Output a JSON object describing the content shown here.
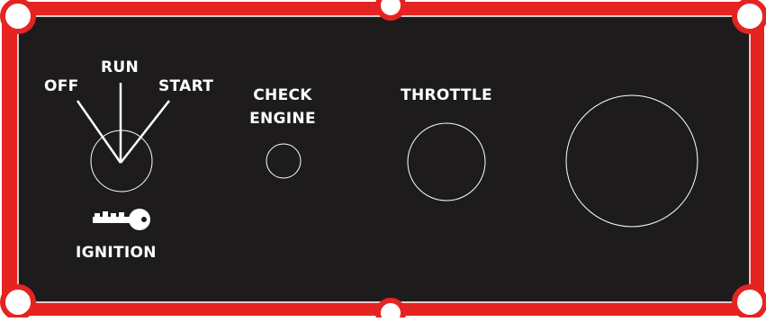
{
  "colors": {
    "frame": "#e52421",
    "panel": "#1e1b1c",
    "text": "#ffffff",
    "outline": "#ffffff"
  },
  "ignition": {
    "positions": [
      "OFF",
      "RUN",
      "START"
    ],
    "label": "IGNITION",
    "icon": "key-icon"
  },
  "check_engine": {
    "line1": "CHECK",
    "line2": "ENGINE"
  },
  "throttle": {
    "label": "THROTTLE"
  }
}
